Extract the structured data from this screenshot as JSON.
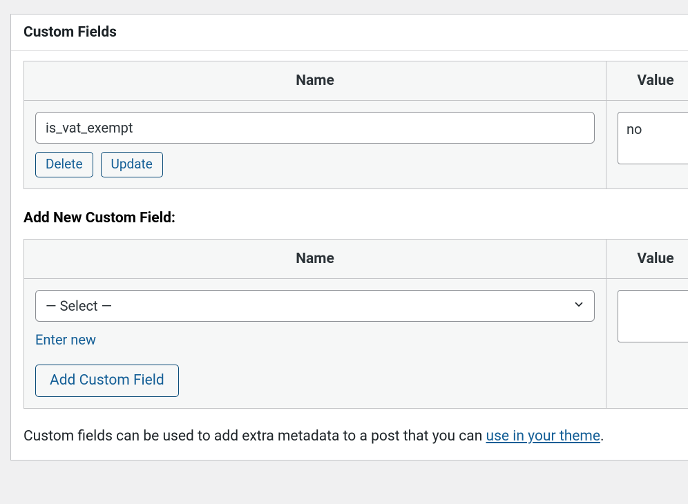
{
  "panel": {
    "title": "Custom Fields"
  },
  "columns": {
    "name": "Name",
    "value": "Value"
  },
  "rows": [
    {
      "key": "is_vat_exempt",
      "value": "no",
      "delete_label": "Delete",
      "update_label": "Update"
    }
  ],
  "add_section": {
    "title": "Add New Custom Field:",
    "select_placeholder": "— Select —",
    "enter_new_label": "Enter new",
    "add_button_label": "Add Custom Field",
    "value": ""
  },
  "footnote": {
    "text_before": "Custom fields can be used to add extra metadata to a post that you can ",
    "link_text": "use in your theme",
    "text_after": "."
  }
}
